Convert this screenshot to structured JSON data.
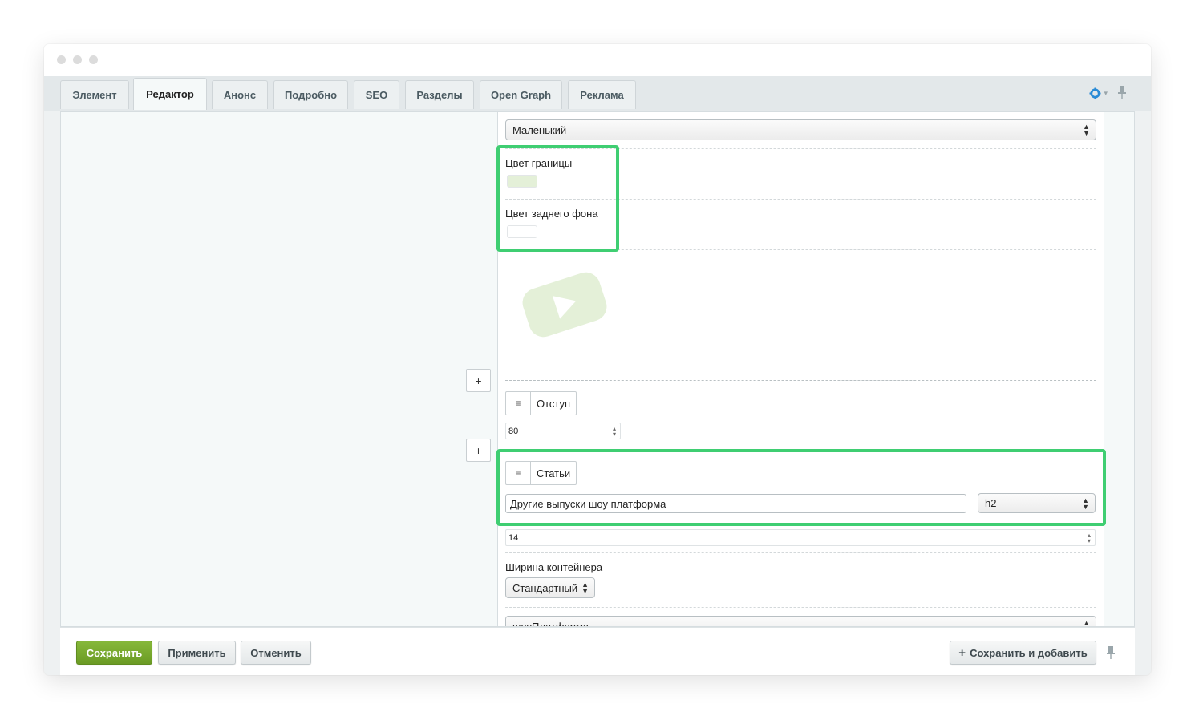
{
  "tabs": [
    {
      "label": "Элемент",
      "active": false
    },
    {
      "label": "Редактор",
      "active": true
    },
    {
      "label": "Анонс",
      "active": false
    },
    {
      "label": "Подробно",
      "active": false
    },
    {
      "label": "SEO",
      "active": false
    },
    {
      "label": "Разделы",
      "active": false
    },
    {
      "label": "Open Graph",
      "active": false
    },
    {
      "label": "Реклама",
      "active": false
    }
  ],
  "toolbar_icons": [
    "gear-icon",
    "pin-icon"
  ],
  "editor": {
    "size_select": "Маленький",
    "border_color_label": "Цвет границы",
    "border_color_value": "#e4f0d8",
    "bg_color_label": "Цвет заднего фона",
    "bg_color_value": "#ffffff",
    "video_placeholder_icon": "youtube-play-icon",
    "spacer_block_title": "Отступ",
    "spacer_value": "80",
    "articles_block_title": "Статьи",
    "articles_title_value": "Другие выпуски шоу платформа",
    "heading_level": "h2",
    "articles_count": "14",
    "container_width_label": "Ширина контейнера",
    "container_width_value": "Стандартный",
    "bottom_select": "шоуПлатформа",
    "add_block_label": "+",
    "handle_symbol": "≡"
  },
  "footer": {
    "save": "Сохранить",
    "apply": "Применить",
    "cancel": "Отменить",
    "save_add": "Сохранить и добавить"
  },
  "colors": {
    "highlight": "#3fce72",
    "primary_button": "#76a72d",
    "accent": "#2a8bd6"
  }
}
